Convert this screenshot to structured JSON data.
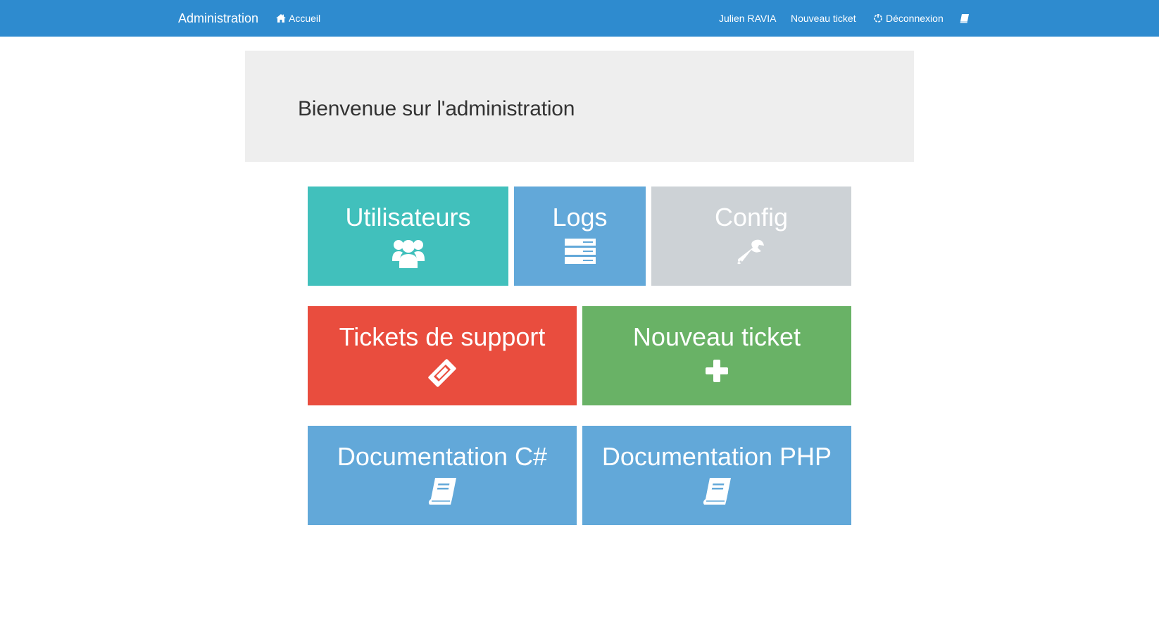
{
  "navbar": {
    "brand": "Administration",
    "home_label": "Accueil",
    "user_label": "Julien RAVIA",
    "new_ticket_label": "Nouveau ticket",
    "logout_label": "Déconnexion",
    "color": "#2e8bcf"
  },
  "jumbotron": {
    "title": "Bienvenue sur l'administration"
  },
  "tiles": [
    {
      "label": "Utilisateurs",
      "icon": "users-icon",
      "color": "#41c0bc"
    },
    {
      "label": "Logs",
      "icon": "server-icon",
      "color": "#62a8d9"
    },
    {
      "label": "Config",
      "icon": "wrench-icon",
      "color": "#cdd2d6"
    },
    {
      "label": "Tickets de support",
      "icon": "ticket-icon",
      "color": "#e94d3e"
    },
    {
      "label": "Nouveau ticket",
      "icon": "plus-icon",
      "color": "#69b266"
    },
    {
      "label": "Documentation C#",
      "icon": "book-icon",
      "color": "#62a8d9"
    },
    {
      "label": "Documentation PHP",
      "icon": "book-icon",
      "color": "#62a8d9"
    }
  ]
}
